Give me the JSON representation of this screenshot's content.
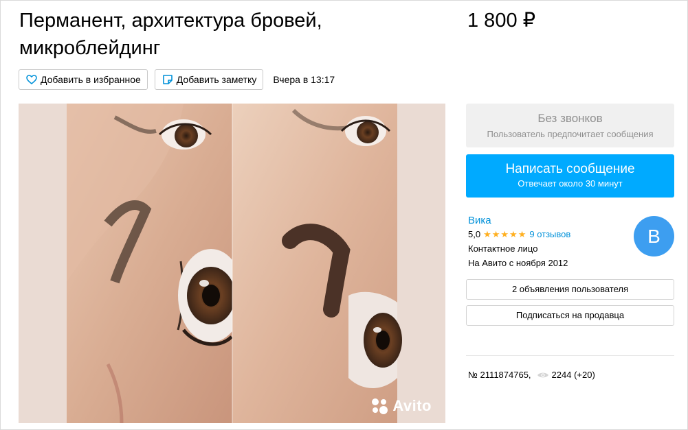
{
  "listing": {
    "title": "Перманент, архитектура бровей, микроблейдинг",
    "price": "1 800 ₽",
    "date": "Вчера в 13:17",
    "number": "№ 2111874765,",
    "views": "2244 (+20)"
  },
  "actions": {
    "favorite_label": "Добавить в избранное",
    "note_label": "Добавить заметку"
  },
  "gallery": {
    "watermark": "Avito"
  },
  "contact": {
    "no_calls_title": "Без звонков",
    "no_calls_subtitle": "Пользователь предпочитает сообщения",
    "write_label": "Написать сообщение",
    "write_sublabel": "Отвечает около 30 минут"
  },
  "seller": {
    "name": "Вика",
    "rating": "5,0",
    "stars": 5,
    "reviews": "9 отзывов",
    "role": "Контактное лицо",
    "since": "На Авито с ноября 2012",
    "avatar_letter": "B"
  },
  "buttons": {
    "user_ads": "2 объявления пользователя",
    "subscribe": "Подписаться на продавца"
  },
  "colors": {
    "accent": "#00aaff",
    "link": "#0091d9",
    "star": "#ffb021",
    "avatar": "#3d9ef0"
  },
  "icons": [
    "heart-icon",
    "note-icon",
    "eye-icon",
    "star-icon"
  ]
}
